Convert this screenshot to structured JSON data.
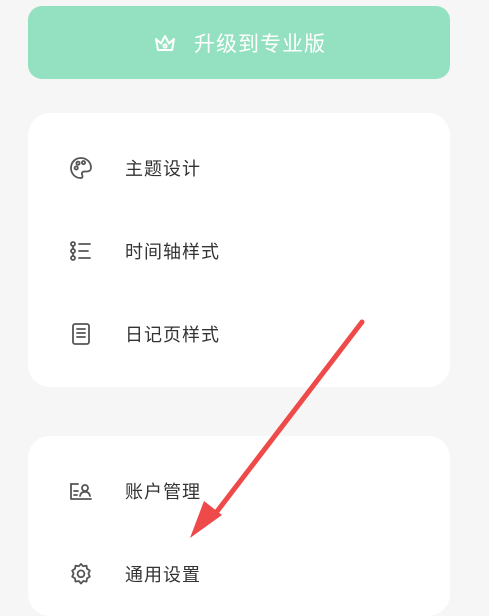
{
  "upgrade": {
    "label": "升级到专业版",
    "icon": "crown-icon",
    "color": "#93e1c0"
  },
  "menu_group_1": [
    {
      "label": "主题设计",
      "icon": "palette-icon"
    },
    {
      "label": "时间轴样式",
      "icon": "timeline-icon"
    },
    {
      "label": "日记页样式",
      "icon": "journal-page-icon"
    }
  ],
  "menu_group_2": [
    {
      "label": "账户管理",
      "icon": "account-card-icon"
    },
    {
      "label": "通用设置",
      "icon": "gear-icon"
    }
  ],
  "annotation": {
    "icon": "red-arrow",
    "color": "#ef4a4a"
  }
}
